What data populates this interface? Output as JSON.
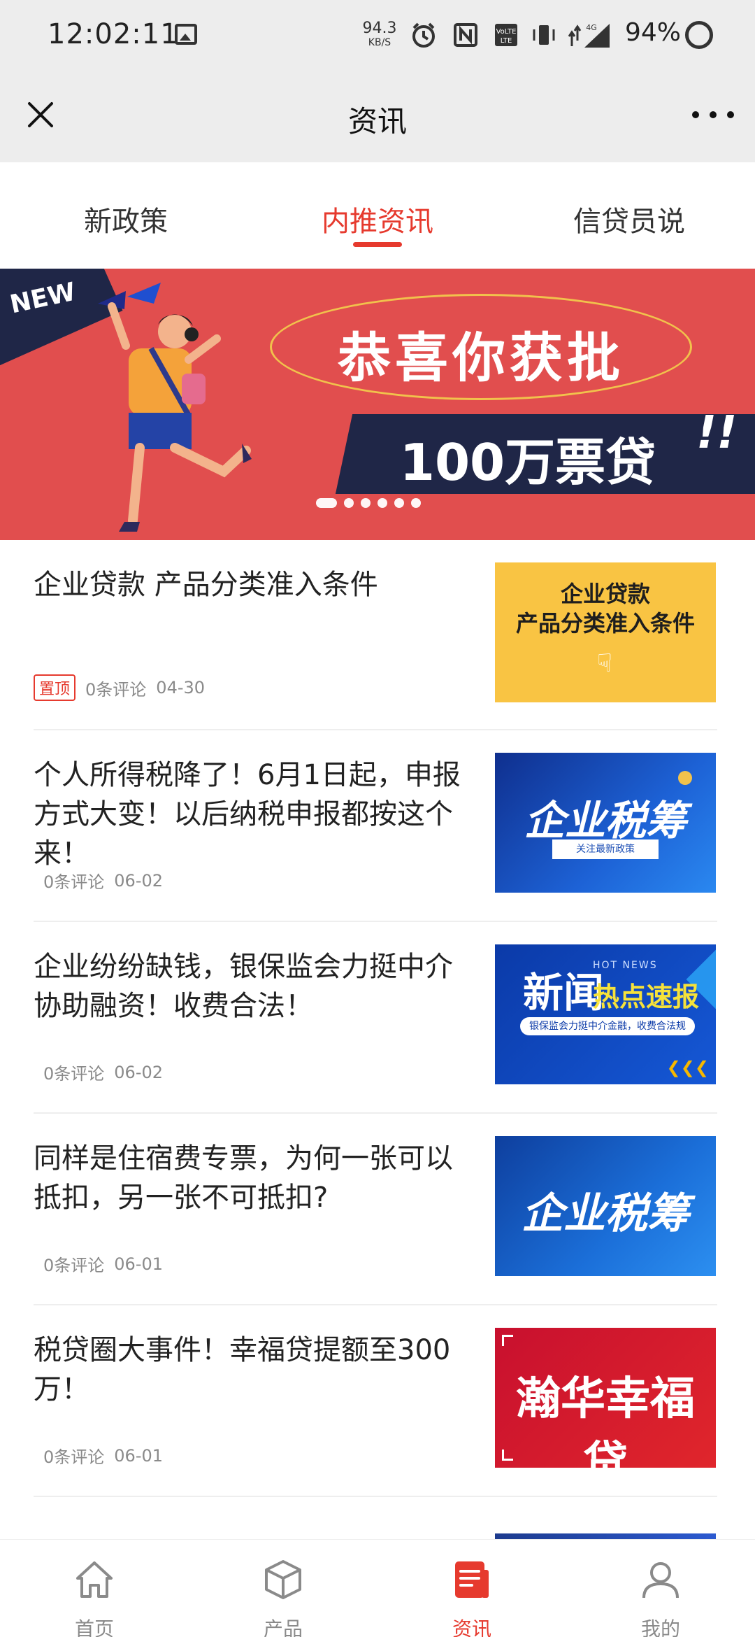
{
  "status_bar": {
    "time": "12:02:11",
    "speed_value": "94.3",
    "speed_unit": "KB/S",
    "network": "4G",
    "battery": "94%"
  },
  "title_bar": {
    "title": "资讯",
    "close_icon": "close-icon",
    "more_icon": "more-icon"
  },
  "tabs": [
    {
      "label": "新政策",
      "active": false
    },
    {
      "label": "内推资讯",
      "active": true
    },
    {
      "label": "信贷员说",
      "active": false
    }
  ],
  "banner": {
    "badge": "NEW",
    "headline": "恭喜你获批",
    "subline": "100万票贷",
    "exclaim": "!!",
    "dots_total": 6,
    "dot_active": 0
  },
  "news": [
    {
      "title": "企业贷款 产品分类准入条件",
      "pinned_label": "置顶",
      "comments": "0条评论",
      "date": "04-30",
      "thumb": {
        "line1": "企业贷款",
        "line2": "产品分类准入条件"
      }
    },
    {
      "title": "个人所得税降了！6月1日起，申报方式大变！以后纳税申报都按这个来！",
      "comments": "0条评论",
      "date": "06-02",
      "thumb": {
        "big": "企业税筹",
        "pill": "关注最新政策"
      }
    },
    {
      "title": "企业纷纷缺钱，银保监会力挺中介协助融资！收费合法！",
      "comments": "0条评论",
      "date": "06-02",
      "thumb": {
        "hot": "HOT NEWS",
        "xin": "新闻",
        "redian": "热点速报",
        "pill": "银保监会力挺中介金融，收费合法规"
      }
    },
    {
      "title": "同样是住宿费专票，为何一张可以抵扣，另一张不可抵扣?",
      "comments": "0条评论",
      "date": "06-01",
      "thumb": {
        "big": "企业税筹"
      }
    },
    {
      "title": "税贷圈大事件！幸福贷提额至300万！",
      "comments": "0条评论",
      "date": "06-01",
      "thumb": {
        "big": "瀚华幸福贷"
      }
    }
  ],
  "bottom_nav": [
    {
      "label": "首页",
      "icon": "home-icon",
      "active": false
    },
    {
      "label": "产品",
      "icon": "cube-icon",
      "active": false
    },
    {
      "label": "资讯",
      "icon": "news-icon",
      "active": true
    },
    {
      "label": "我的",
      "icon": "user-icon",
      "active": false
    }
  ],
  "colors": {
    "accent": "#e63a2e",
    "banner_bg": "#e14e4e",
    "banner_dark": "#1f2647",
    "bar_bg": "#ededed"
  }
}
